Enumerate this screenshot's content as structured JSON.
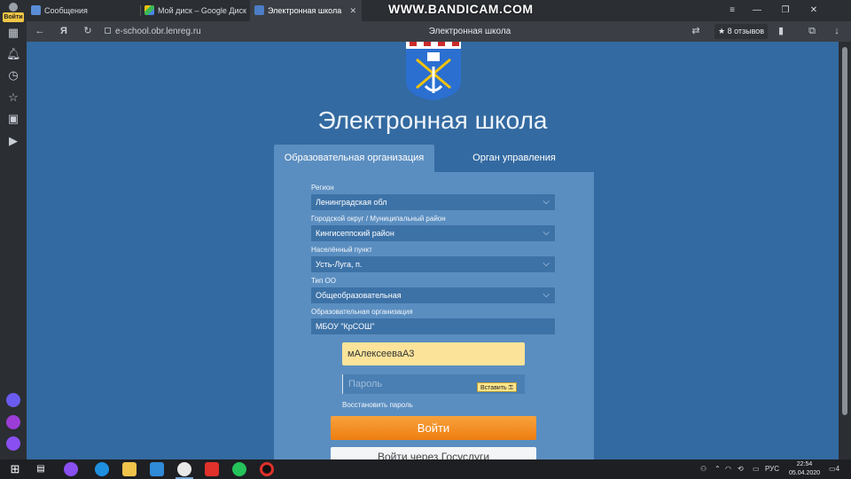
{
  "sidebar": {
    "profile_button": "Войти"
  },
  "tabs": [
    {
      "title": "Сообщения"
    },
    {
      "title": "Мой диск – Google Диск"
    },
    {
      "title": "Электронная школа"
    }
  ],
  "watermark": "WWW.BANDICAM.COM",
  "address_bar": {
    "url": "e-school.obr.lenreg.ru",
    "page_title": "Электронная школа",
    "reviews": "★ 8 отзывов"
  },
  "page": {
    "site_title": "Электронная школа",
    "tab_org": "Образовательная организация",
    "tab_gov": "Орган управления",
    "fields": [
      {
        "label": "Регион",
        "value": "Ленинградская обл"
      },
      {
        "label": "Городской округ / Муниципальный район",
        "value": "Кингисеппский район"
      },
      {
        "label": "Населённый пункт",
        "value": "Усть-Луга, п."
      },
      {
        "label": "Тип ОО",
        "value": "Общеобразовательная"
      },
      {
        "label": "Образовательная организация",
        "value": "МБОУ \"КрСОШ\""
      }
    ],
    "login_value": "мАлексееваА3",
    "password_placeholder": "Пароль",
    "paste_tooltip": "Вставить",
    "restore_link": "Восстановить пароль",
    "login_button": "Войти",
    "secondary_button": "Войти через Госуслуги"
  },
  "taskbar": {
    "lang": "РУС",
    "time": "22:54",
    "date": "05.04.2020",
    "notifications": "4"
  },
  "colors": {
    "page_bg": "#336aa1",
    "form_bg": "#5b8ec0",
    "login_button": "#f28a1c",
    "login_field": "#fbe39a"
  }
}
